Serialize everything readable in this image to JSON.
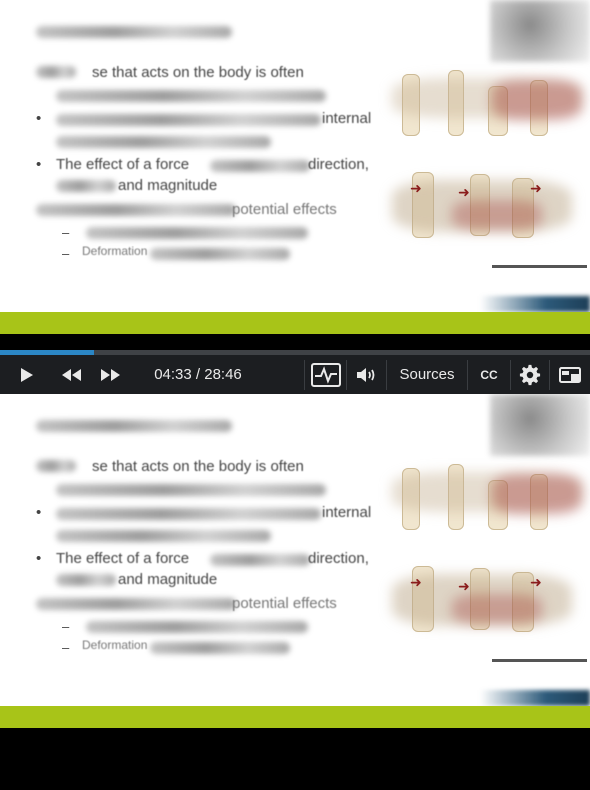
{
  "slide": {
    "visible_fragments": [
      "se that acts on the body is often",
      "internal",
      "The effect of a force",
      "direction,",
      "and magnitude",
      "potential effects",
      "Deformation"
    ]
  },
  "player": {
    "progress_fraction": 0.159,
    "time_display": "04:33 / 28:46",
    "sources_label": "Sources",
    "cc_label": "CC",
    "icons": {
      "play": "play-icon",
      "rewind": "rewind-icon",
      "forward": "fast-forward-icon",
      "analytics": "pulse-icon",
      "volume": "volume-icon",
      "settings": "gear-icon",
      "layout": "layout-icon"
    },
    "accent": "#2b86c5",
    "bar_color": "#1c1e21"
  },
  "colors": {
    "green_band": "#a8c418",
    "slide_bg": "#ffffff"
  }
}
